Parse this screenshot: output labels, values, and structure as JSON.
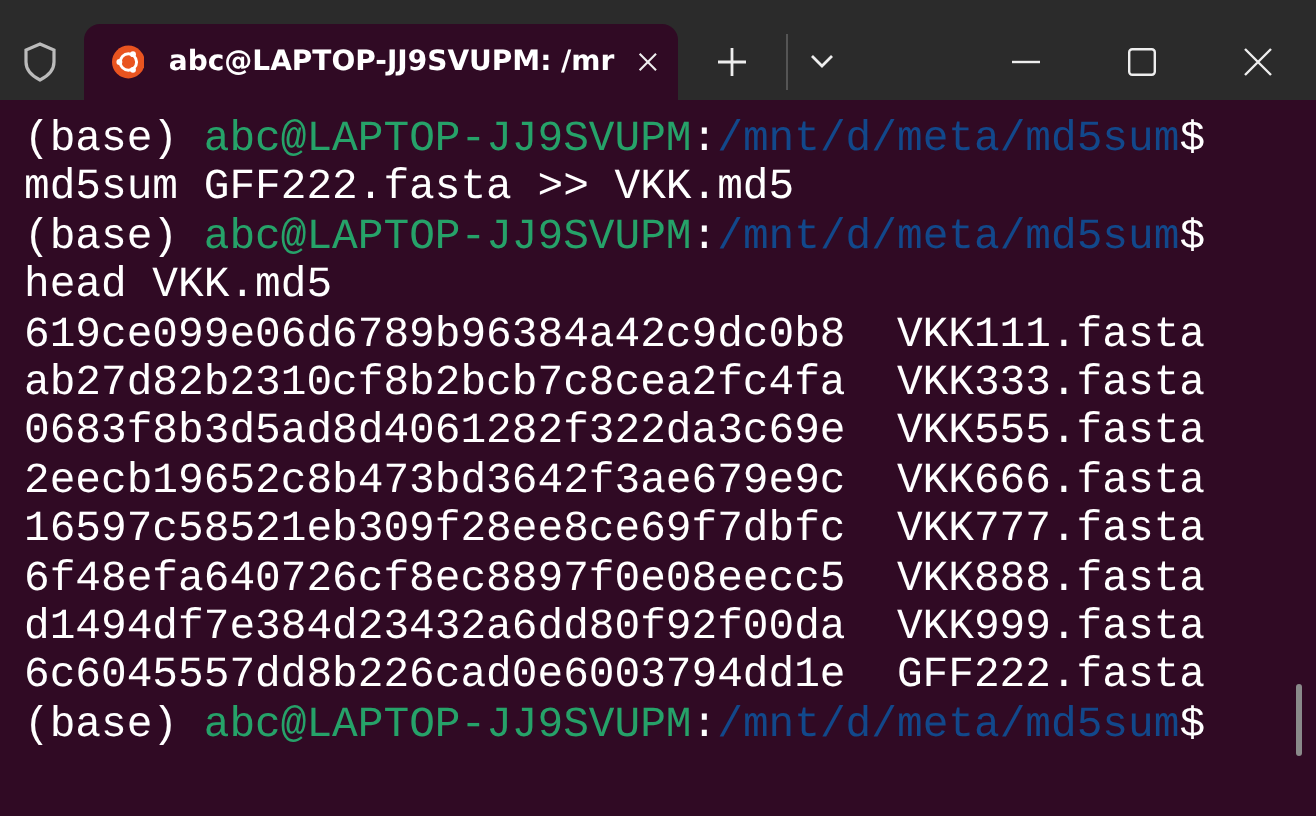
{
  "window": {
    "tab_title": "abc@LAPTOP-JJ9SVUPM: /mr"
  },
  "lines": [
    {
      "kind": "prompt",
      "env": "(base)",
      "user_host": "abc@LAPTOP-JJ9SVUPM",
      "separator": ":",
      "path": "/mnt/d/meta/md5sum",
      "symbol": "$"
    },
    {
      "kind": "output",
      "text": "md5sum GFF222.fasta >> VKK.md5"
    },
    {
      "kind": "prompt",
      "env": "(base)",
      "user_host": "abc@LAPTOP-JJ9SVUPM",
      "separator": ":",
      "path": "/mnt/d/meta/md5sum",
      "symbol": "$"
    },
    {
      "kind": "output",
      "text": "head VKK.md5"
    },
    {
      "kind": "checksum",
      "hash": "619ce099e06d6789b96384a42c9dc0b8",
      "file": "VKK111.fasta"
    },
    {
      "kind": "checksum",
      "hash": "ab27d82b2310cf8b2bcb7c8cea2fc4fa",
      "file": "VKK333.fasta"
    },
    {
      "kind": "checksum",
      "hash": "0683f8b3d5ad8d4061282f322da3c69e",
      "file": "VKK555.fasta"
    },
    {
      "kind": "checksum",
      "hash": "2eecb19652c8b473bd3642f3ae679e9c",
      "file": "VKK666.fasta"
    },
    {
      "kind": "checksum",
      "hash": "16597c58521eb309f28ee8ce69f7dbfc",
      "file": "VKK777.fasta"
    },
    {
      "kind": "checksum",
      "hash": "6f48efa640726cf8ec8897f0e08eecc5",
      "file": "VKK888.fasta"
    },
    {
      "kind": "checksum",
      "hash": "d1494df7e384d23432a6dd80f92f00da",
      "file": "VKK999.fasta"
    },
    {
      "kind": "checksum",
      "hash": "6c6045557dd8b226cad0e6003794dd1e",
      "file": "GFF222.fasta"
    },
    {
      "kind": "prompt",
      "env": "(base)",
      "user_host": "abc@LAPTOP-JJ9SVUPM",
      "separator": ":",
      "path": "/mnt/d/meta/md5sum",
      "symbol": "$"
    }
  ]
}
